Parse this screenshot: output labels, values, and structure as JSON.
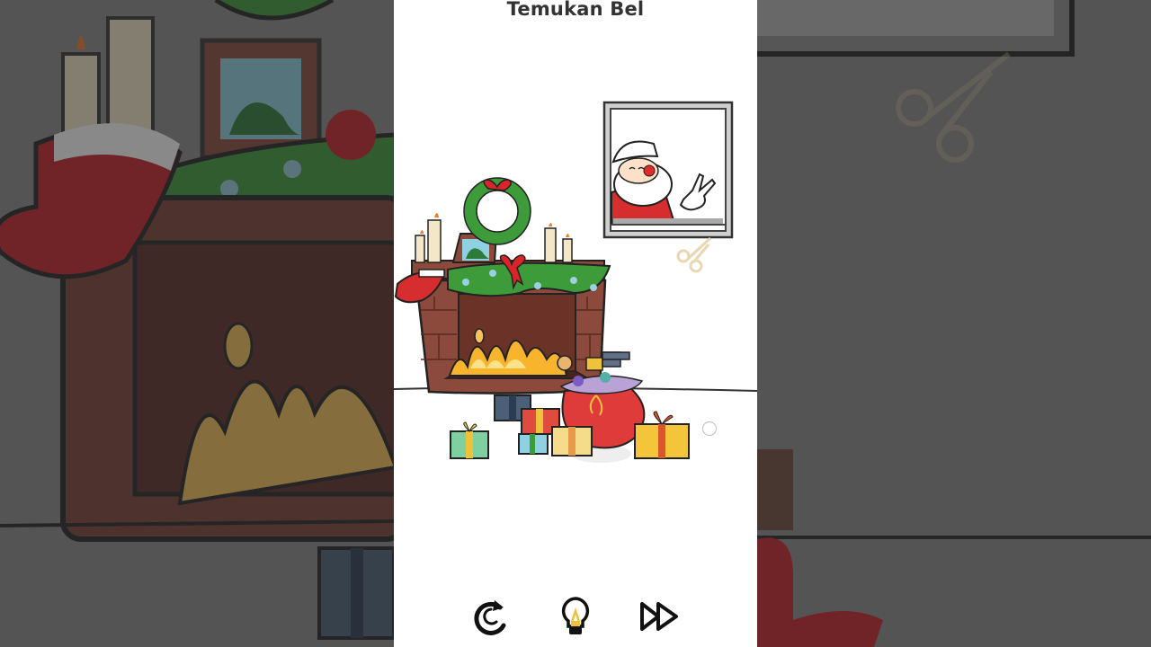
{
  "level": {
    "title": "Temukan Bel"
  },
  "controls": {
    "restart_icon": "restart-icon",
    "hint_icon": "lightbulb-icon",
    "skip_icon": "fast-forward-icon"
  },
  "colors": {
    "background_blur": "#6e6e6e",
    "phone_bg": "#ffffff",
    "brick": "#8b4a3c",
    "fire": "#f7b42c",
    "wreath": "#3d9b3a",
    "ribbon": "#d9252a",
    "santa_suit": "#d62e2e"
  }
}
